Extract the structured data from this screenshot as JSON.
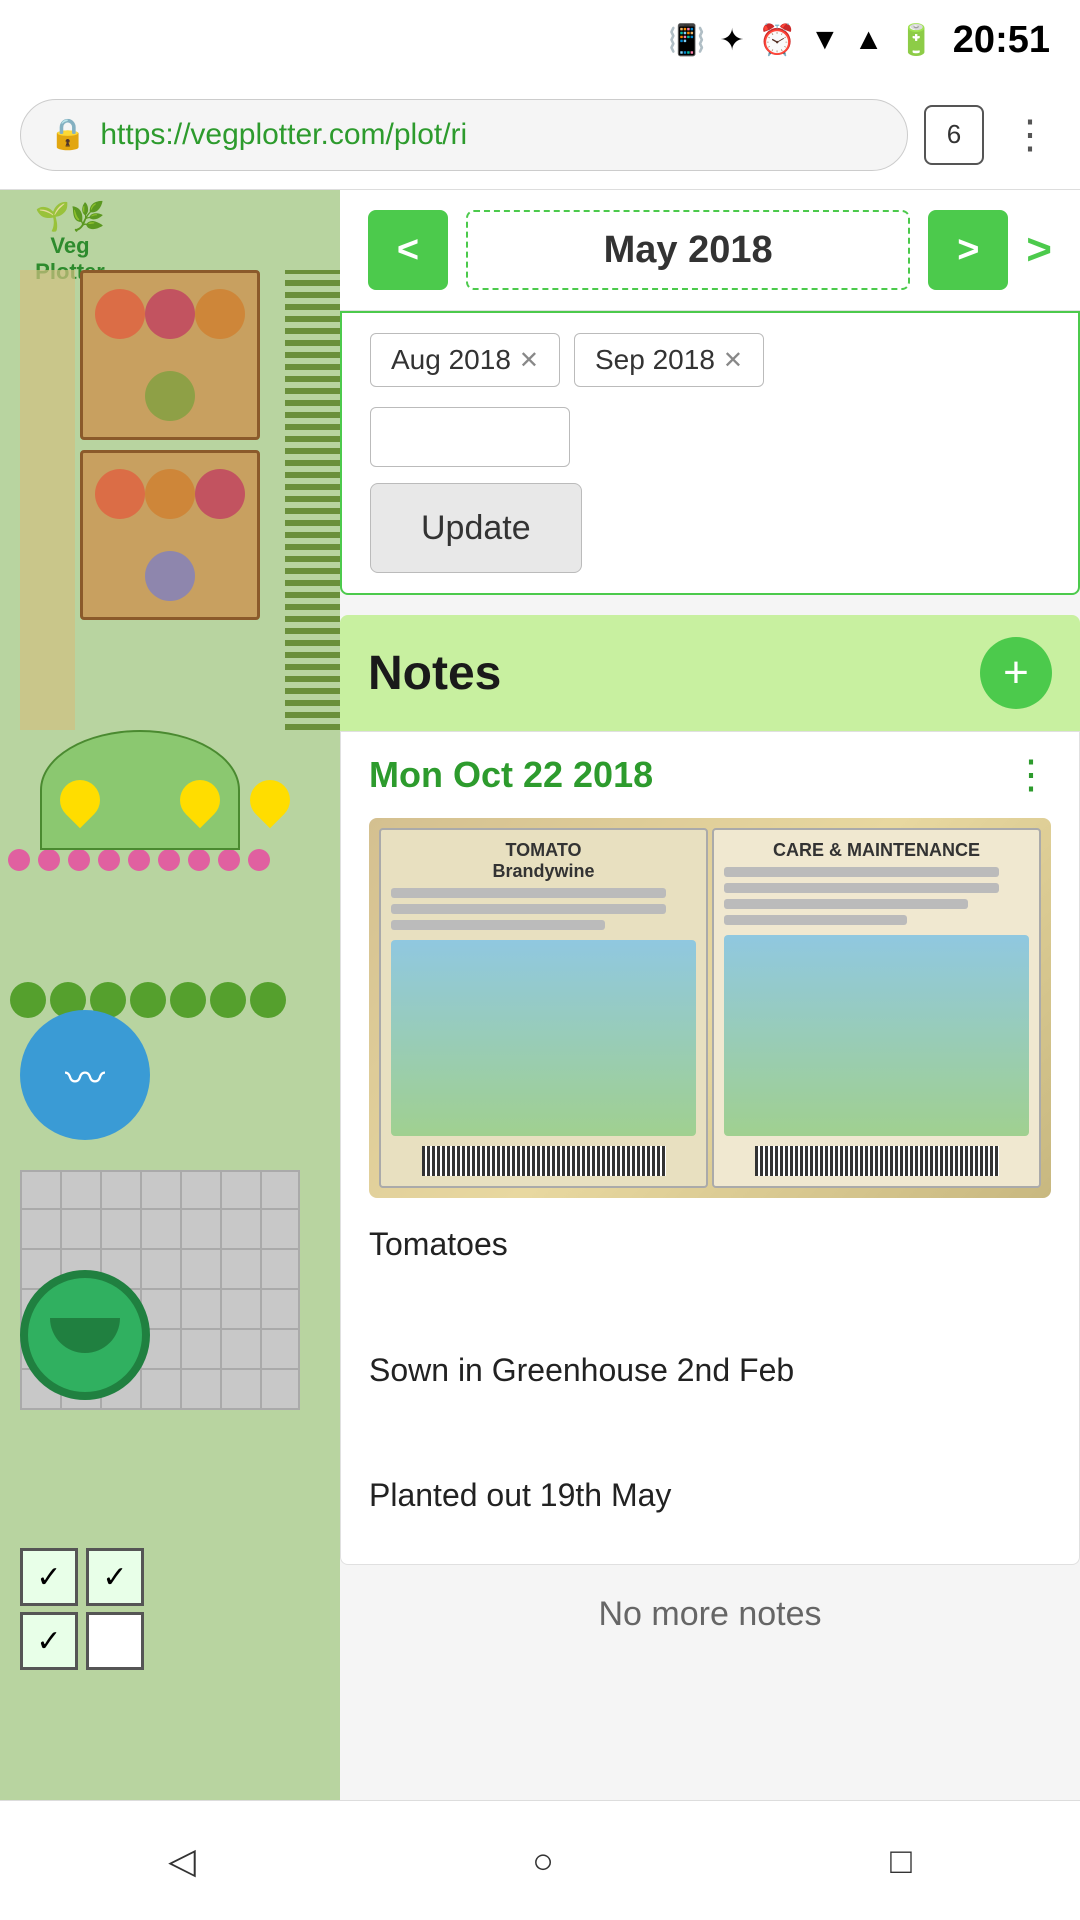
{
  "statusBar": {
    "time": "20:51",
    "icons": [
      "vibrate",
      "bluetooth",
      "alarm",
      "signal-off",
      "signal-bars",
      "battery"
    ]
  },
  "browser": {
    "url": "https://vegplotter.com/plot/ri",
    "tabCount": "6"
  },
  "nav": {
    "prevLabel": "<",
    "nextLabel": ">",
    "monthDisplay": "May 2018",
    "arrowRight": ">"
  },
  "filters": {
    "tags": [
      {
        "label": "Aug 2018",
        "id": "aug2018"
      },
      {
        "label": "Sep 2018",
        "id": "sep2018"
      }
    ],
    "inputPlaceholder": "",
    "updateButton": "Update"
  },
  "notes": {
    "title": "Notes",
    "addButton": "+",
    "noteDate": "Mon Oct 22 2018",
    "noteMenuIcon": "⋮",
    "noteLines": [
      "Tomatoes",
      "",
      "Sown in Greenhouse 2nd Feb",
      "",
      "Planted out 19th May"
    ],
    "noMoreNotes": "No more notes"
  },
  "logo": {
    "text": "Veg\nPlotter"
  },
  "bottomNav": {
    "back": "◁",
    "home": "○",
    "recent": "□"
  },
  "colors": {
    "green": "#4cca4c",
    "darkGreen": "#2d9b2d",
    "lightGreenBg": "#c8f0a0",
    "orange": "#c8a060"
  }
}
